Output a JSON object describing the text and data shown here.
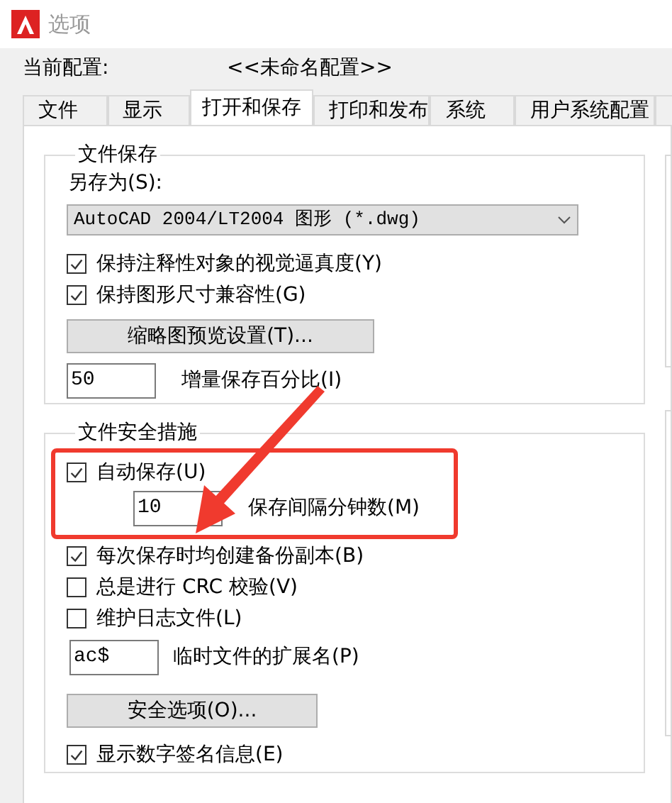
{
  "window": {
    "title": "选项"
  },
  "profile": {
    "label": "当前配置:",
    "value": "<<未命名配置>>"
  },
  "tabs": [
    {
      "label": "文件",
      "selected": false
    },
    {
      "label": "显示",
      "selected": false
    },
    {
      "label": "打开和保存",
      "selected": true
    },
    {
      "label": "打印和发布",
      "selected": false
    },
    {
      "label": "系统",
      "selected": false
    },
    {
      "label": "用户系统配置",
      "selected": false
    }
  ],
  "file_save": {
    "title": "文件保存",
    "save_as_label": "另存为(S):",
    "save_as_value": "AutoCAD 2004/LT2004 图形 (*.dwg)",
    "options": [
      {
        "label": "保持注释性对象的视觉逼真度(Y)",
        "checked": true
      },
      {
        "label": "保持图形尺寸兼容性(G)",
        "checked": true
      }
    ],
    "thumbnail_button": "缩略图预览设置(T)...",
    "incremental": {
      "value": "50",
      "label": "增量保存百分比(I)"
    }
  },
  "file_safety": {
    "title": "文件安全措施",
    "autosave": {
      "label": "自动保存(U)",
      "checked": true
    },
    "interval": {
      "value": "10",
      "label": "保存间隔分钟数(M)"
    },
    "options": [
      {
        "label": "每次保存时均创建备份副本(B)",
        "checked": true
      },
      {
        "label": "总是进行 CRC 校验(V)",
        "checked": false
      },
      {
        "label": "维护日志文件(L)",
        "checked": false
      }
    ],
    "temp_ext": {
      "value": "ac$",
      "label": "临时文件的扩展名(P)"
    },
    "security_button": "安全选项(O)...",
    "digital_signature": {
      "label": "显示数字签名信息(E)",
      "checked": true
    }
  }
}
